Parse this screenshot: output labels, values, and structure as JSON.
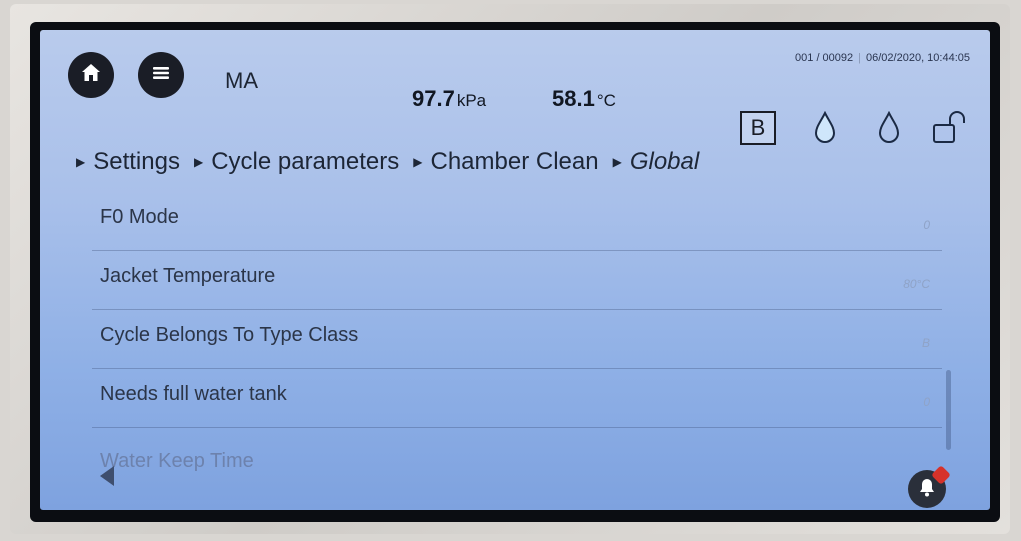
{
  "header": {
    "user": "MA",
    "counter": "001 / 00092",
    "datetime": "06/02/2020, 10:44:05",
    "pressure_value": "97.7",
    "pressure_unit": "kPa",
    "temperature_value": "58.1",
    "temperature_unit": "°C",
    "mode_badge": "B",
    "icons": [
      "home-icon",
      "menu-icon",
      "water-drop-filled-icon",
      "water-drop-outline-icon",
      "unlocked-padlock-icon"
    ]
  },
  "breadcrumb": [
    "Settings",
    "Cycle parameters",
    "Chamber Clean",
    "Global"
  ],
  "parameters": [
    {
      "label": "F0 Mode",
      "value": "0"
    },
    {
      "label": "Jacket Temperature",
      "value": "80°C"
    },
    {
      "label": "Cycle Belongs To Type Class",
      "value": "B"
    },
    {
      "label": "Needs full water tank",
      "value": "0"
    },
    {
      "label": "Water Keep Time",
      "value": ""
    }
  ],
  "footer": {
    "back_icon": "back-arrow-icon",
    "alarm_icon": "alarm-bell-icon",
    "alarm_indicator_color": "#d6322a"
  }
}
